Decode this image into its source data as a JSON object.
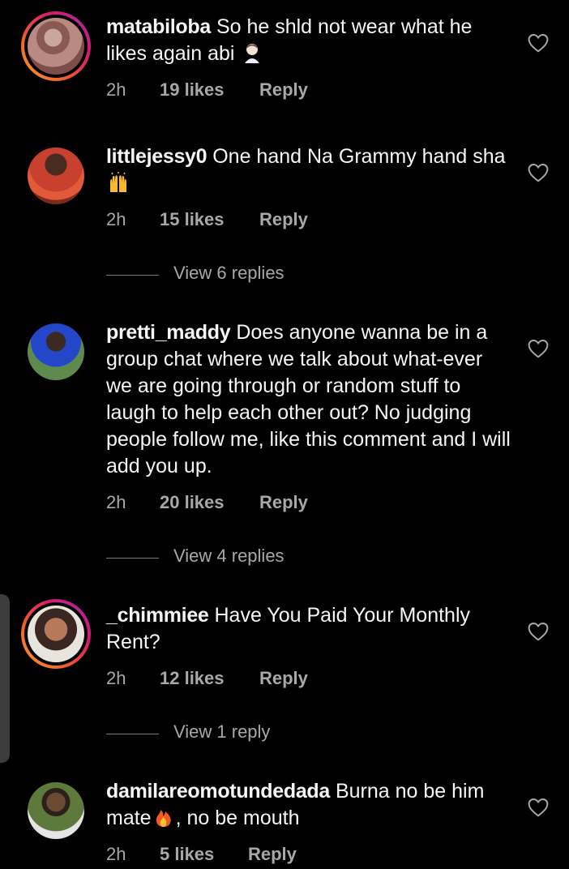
{
  "comments": [
    {
      "username": "matabiloba",
      "text": "So he shld not wear what he likes again abi",
      "emoji": "facepalm",
      "time": "2h",
      "likes": "19 likes",
      "reply": "Reply",
      "has_story_ring": true
    },
    {
      "username": "littlejessy0",
      "text": "One hand Na Grammy hand sha",
      "emoji": "raising-hands",
      "time": "2h",
      "likes": "15 likes",
      "reply": "Reply",
      "view_replies": "View 6 replies",
      "has_story_ring": false
    },
    {
      "username": "pretti_maddy",
      "text": "Does anyone wanna be in a group chat where we talk about what-ever we are going through or random stuff to laugh to help each other out? No judging people follow me, like this comment and I will add you up.",
      "time": "2h",
      "likes": "20 likes",
      "reply": "Reply",
      "view_replies": "View 4 replies",
      "has_story_ring": false
    },
    {
      "username": "_chimmiee",
      "text": "Have You Paid Your Monthly Rent?",
      "time": "2h",
      "likes": "12 likes",
      "reply": "Reply",
      "view_replies": "View 1 reply",
      "has_story_ring": true
    },
    {
      "username": "damilareomotundedada",
      "text_before_emoji": "Burna no be him mate",
      "emoji": "fire",
      "text_after_emoji": ", no be mouth",
      "time": "2h",
      "likes": "5 likes",
      "reply": "Reply",
      "has_story_ring": false
    }
  ],
  "icons": {
    "like": "heart-outline-icon"
  },
  "colors": {
    "background": "#000000",
    "text": "#f5f5f5",
    "secondary_text": "#a8a8a8",
    "story_ring": [
      "#f9a12e",
      "#d61a6e",
      "#9b2dbd"
    ]
  }
}
